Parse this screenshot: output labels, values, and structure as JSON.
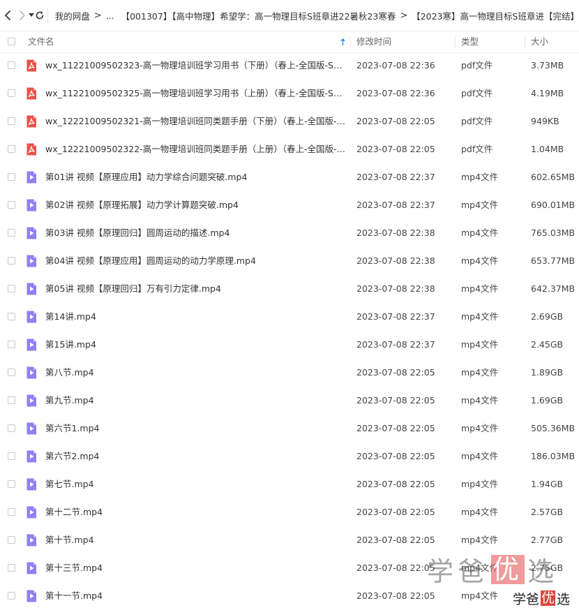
{
  "breadcrumb": {
    "items": [
      "我的网盘",
      "...",
      "【001307】【高中物理】希望学：高一物理目标S班章进22暑秋23寒春",
      "【2023寒】高一物理目标S班章进【完结】"
    ]
  },
  "columns": {
    "name": "文件名",
    "modified": "修改时间",
    "type": "类型",
    "size": "大小"
  },
  "colors": {
    "pdf_icon": "#e8534a",
    "video_icon": "#8f80f3",
    "sort_arrow": "#1a8cff"
  },
  "icons": {
    "pdf": "pdf-file-icon",
    "video": "video-file-icon"
  },
  "files": [
    {
      "icon": "pdf",
      "name": "wx_11221009502323-高一物理培训班学习用书（下册）（春上-全国版-S）-...",
      "modified": "2023-07-08 22:36",
      "type": "pdf文件",
      "size": "3.73MB"
    },
    {
      "icon": "pdf",
      "name": "wx_11221009502325-高一物理培训班学习用书（上册）（春上-全国版-S）-...",
      "modified": "2023-07-08 22:36",
      "type": "pdf文件",
      "size": "4.19MB"
    },
    {
      "icon": "pdf",
      "name": "wx_12221009502321-高一物理培训班同类题手册（下册）（春上-全国版-S）...",
      "modified": "2023-07-08 22:05",
      "type": "pdf文件",
      "size": "949KB"
    },
    {
      "icon": "pdf",
      "name": "wx_12221009502322-高一物理培训班同类题手册（上册）（春上-全国版-S）...",
      "modified": "2023-07-08 22:05",
      "type": "pdf文件",
      "size": "1.04MB"
    },
    {
      "icon": "video",
      "name": "第01讲 视频【原理应用】动力学综合问题突破.mp4",
      "modified": "2023-07-08 22:37",
      "type": "mp4文件",
      "size": "602.65MB"
    },
    {
      "icon": "video",
      "name": "第02讲 视频【原理拓展】动力学计算题突破.mp4",
      "modified": "2023-07-08 22:37",
      "type": "mp4文件",
      "size": "690.01MB"
    },
    {
      "icon": "video",
      "name": "第03讲 视频【原理回归】圆周运动的描述.mp4",
      "modified": "2023-07-08 22:38",
      "type": "mp4文件",
      "size": "765.03MB"
    },
    {
      "icon": "video",
      "name": "第04讲 视频【原理应用】圆周运动的动力学原理.mp4",
      "modified": "2023-07-08 22:38",
      "type": "mp4文件",
      "size": "653.77MB"
    },
    {
      "icon": "video",
      "name": "第05讲 视频【原理回归】万有引力定律.mp4",
      "modified": "2023-07-08 22:38",
      "type": "mp4文件",
      "size": "642.37MB"
    },
    {
      "icon": "video",
      "name": "第14讲.mp4",
      "modified": "2023-07-08 22:37",
      "type": "mp4文件",
      "size": "2.69GB"
    },
    {
      "icon": "video",
      "name": "第15讲.mp4",
      "modified": "2023-07-08 22:37",
      "type": "mp4文件",
      "size": "2.45GB"
    },
    {
      "icon": "video",
      "name": "第八节.mp4",
      "modified": "2023-07-08 22:05",
      "type": "mp4文件",
      "size": "1.89GB"
    },
    {
      "icon": "video",
      "name": "第九节.mp4",
      "modified": "2023-07-08 22:05",
      "type": "mp4文件",
      "size": "1.69GB"
    },
    {
      "icon": "video",
      "name": "第六节1.mp4",
      "modified": "2023-07-08 22:05",
      "type": "mp4文件",
      "size": "505.36MB"
    },
    {
      "icon": "video",
      "name": "第六节2.mp4",
      "modified": "2023-07-08 22:05",
      "type": "mp4文件",
      "size": "186.03MB"
    },
    {
      "icon": "video",
      "name": "第七节.mp4",
      "modified": "2023-07-08 22:05",
      "type": "mp4文件",
      "size": "1.94GB"
    },
    {
      "icon": "video",
      "name": "第十二节.mp4",
      "modified": "2023-07-08 22:05",
      "type": "mp4文件",
      "size": "2.57GB"
    },
    {
      "icon": "video",
      "name": "第十节.mp4",
      "modified": "2023-07-08 22:05",
      "type": "mp4文件",
      "size": "2.77GB"
    },
    {
      "icon": "video",
      "name": "第十三节.mp4",
      "modified": "2023-07-08 22:05",
      "type": "mp4文件",
      "size": "2.75GB"
    },
    {
      "icon": "video",
      "name": "第十一节.mp4",
      "modified": "2023-07-08 22:05",
      "type": "mp4文件",
      "size": ""
    }
  ],
  "watermark": {
    "large": [
      "学",
      "爸",
      "优",
      "选"
    ],
    "small": [
      "学",
      "爸",
      "优",
      "选"
    ]
  }
}
